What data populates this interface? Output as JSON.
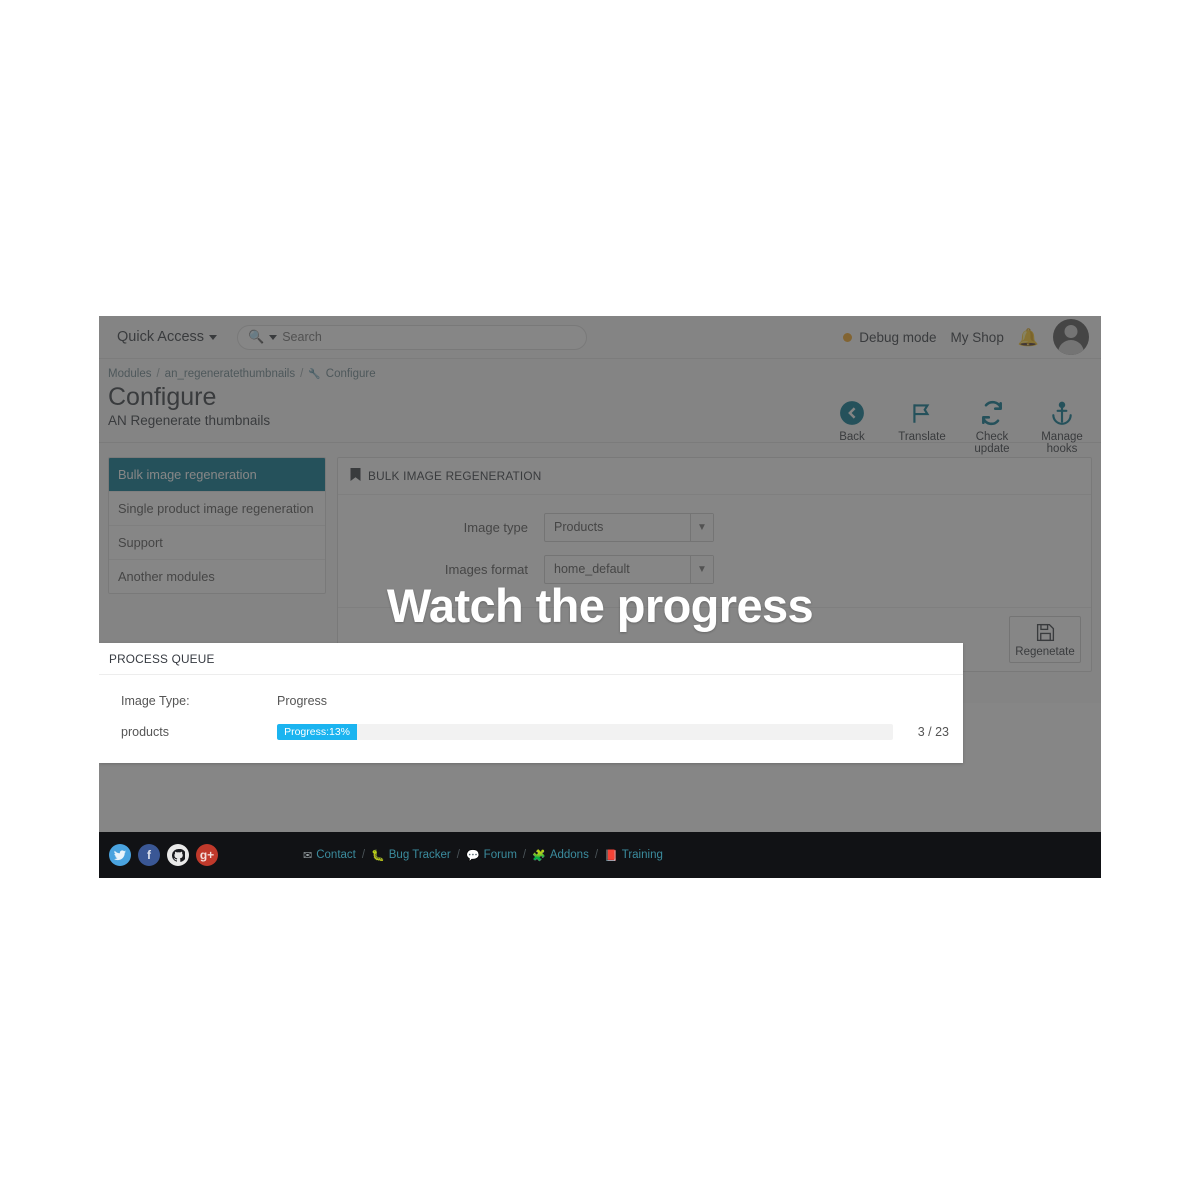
{
  "topbar": {
    "quick_access_label": "Quick Access",
    "quick_access_icon": "chevron-down-icon",
    "search_icon": "search-icon",
    "search_value": "",
    "search_placeholder": "Search",
    "debug_label": "Debug mode",
    "debug_dot_color": "#f5a623",
    "shop_label": "My Shop",
    "bell_icon": "bell-icon",
    "avatar_icon": "avatar-icon"
  },
  "breadcrumb": {
    "items": [
      "Modules",
      "an_regeneratethumbnails",
      "Configure"
    ],
    "separator": "/",
    "last_icon": "wrench-icon"
  },
  "page": {
    "title": "Configure",
    "subtitle": "AN Regenerate thumbnails"
  },
  "toolbar": {
    "items": [
      {
        "label": "Back",
        "icon": "arrow-left-circle-icon"
      },
      {
        "label": "Translate",
        "icon": "flag-icon"
      },
      {
        "label": "Check update",
        "icon": "refresh-icon"
      },
      {
        "label": "Manage hooks",
        "icon": "anchor-icon"
      }
    ],
    "accent_color": "#00758f"
  },
  "sidebar": {
    "items": [
      {
        "label": "Bulk image regeneration",
        "active": true
      },
      {
        "label": "Single product image regeneration",
        "active": false
      },
      {
        "label": "Support",
        "active": false
      },
      {
        "label": "Another modules",
        "active": false
      }
    ],
    "active_color": "#00758f"
  },
  "main": {
    "panel_title": "BULK IMAGE REGENERATION",
    "panel_icon": "bookmark-icon",
    "fields": [
      {
        "label": "Image type",
        "value": "Products",
        "icon": "chevron-down-icon"
      },
      {
        "label": "Images format",
        "value": "home_default",
        "icon": "chevron-down-icon"
      }
    ],
    "submit": {
      "label": "Regenetate",
      "icon": "floppy-save-icon"
    }
  },
  "queue": {
    "title": "PROCESS QUEUE",
    "columns": [
      "Image Type:",
      "Progress",
      ""
    ],
    "rows": [
      {
        "image_type": "products",
        "progress_label": "Progress:13%",
        "progress_percent": 13,
        "count": "3 / 23"
      }
    ],
    "bar_color": "#1bb4f0"
  },
  "overlay": {
    "headline": "Watch the progress"
  },
  "footer": {
    "socials": [
      {
        "name": "twitter-icon",
        "glyph": "t"
      },
      {
        "name": "facebook-icon",
        "glyph": "f"
      },
      {
        "name": "github-icon",
        "glyph": "●"
      },
      {
        "name": "googleplus-icon",
        "glyph": "g+"
      }
    ],
    "links": [
      {
        "label": "Contact",
        "icon": "envelope-icon"
      },
      {
        "label": "Bug Tracker",
        "icon": "bug-icon"
      },
      {
        "label": "Forum",
        "icon": "comments-icon"
      },
      {
        "label": "Addons",
        "icon": "puzzle-icon"
      },
      {
        "label": "Training",
        "icon": "book-icon"
      }
    ],
    "separator": "/"
  }
}
